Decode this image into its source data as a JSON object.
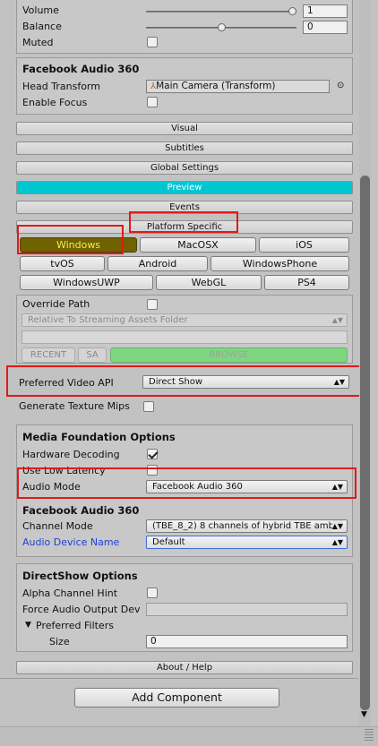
{
  "audio": {
    "volume_label": "Volume",
    "volume_value": "1",
    "volume_level": 1.0,
    "balance_label": "Balance",
    "balance_value": "0",
    "balance_level": 0.5,
    "muted_label": "Muted"
  },
  "fb360_top": {
    "title": "Facebook Audio 360",
    "head_transform_label": "Head Transform",
    "head_transform_value": "Main Camera (Transform)",
    "enable_focus_label": "Enable Focus"
  },
  "sections": {
    "visual": "Visual",
    "subtitles": "Subtitles",
    "global_settings": "Global Settings",
    "preview": "Preview",
    "events": "Events",
    "platform_specific": "Platform Specific",
    "about": "About / Help"
  },
  "platforms": {
    "windows": "Windows",
    "macosx": "MacOSX",
    "ios": "iOS",
    "tvos": "tvOS",
    "android": "Android",
    "windowsphone": "WindowsPhone",
    "windowsuwp": "WindowsUWP",
    "webgl": "WebGL",
    "ps4": "PS4"
  },
  "override": {
    "label": "Override Path",
    "location": "Relative To Streaming Assets Folder",
    "path_value": "",
    "recent": "RECENT",
    "sa": "SA",
    "browse": "BROWSE"
  },
  "video_api": {
    "label": "Preferred Video API",
    "value": "Direct Show"
  },
  "texture_mips_label": "Generate Texture Mips",
  "mf": {
    "title": "Media Foundation Options",
    "hw_decoding_label": "Hardware Decoding",
    "low_latency_label": "Use Low Latency",
    "audio_mode_label": "Audio Mode",
    "audio_mode_value": "Facebook Audio 360"
  },
  "fb360_bottom": {
    "title": "Facebook Audio 360",
    "channel_mode_label": "Channel Mode",
    "channel_mode_value": "(TBE_8_2) 8 channels of hybrid TBE amb",
    "audio_device_label": "Audio Device Name",
    "audio_device_value": "Default"
  },
  "ds": {
    "title": "DirectShow Options",
    "alpha_hint_label": "Alpha Channel Hint",
    "force_output_label": "Force Audio Output Dev",
    "force_output_value": "",
    "preferred_filters_label": "Preferred Filters",
    "size_label": "Size",
    "size_value": "0"
  },
  "add_component": "Add Component",
  "colors": {
    "preview_accent": "#00c6d2",
    "windows_active": "#6e6300",
    "link_blue": "#1f3fd6",
    "highlight_red": "#e11919"
  }
}
